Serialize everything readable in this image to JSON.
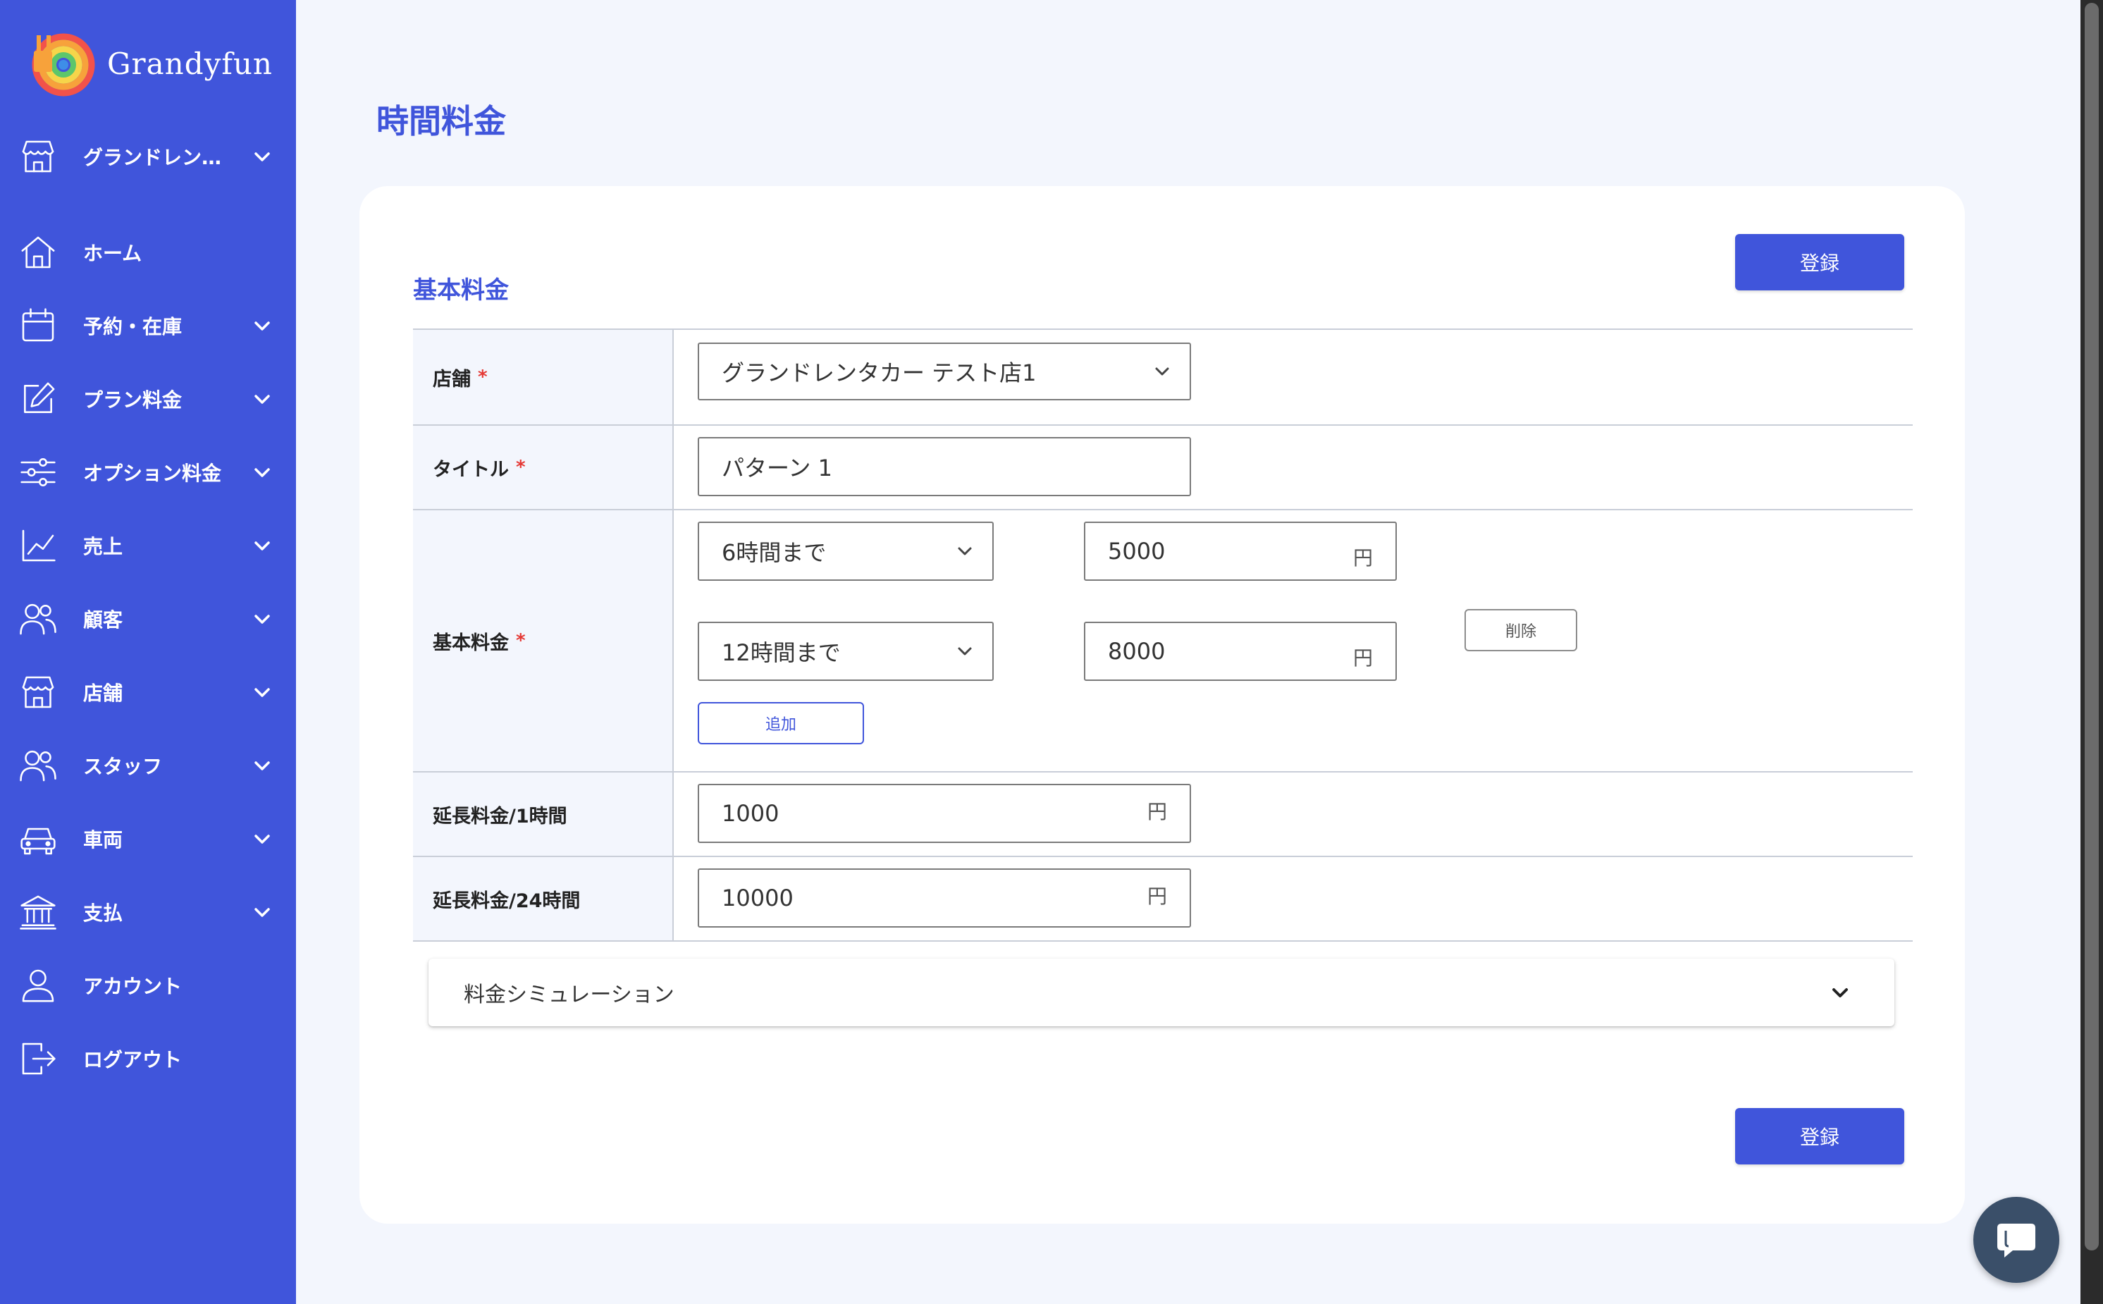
{
  "app": {
    "brand": "Grandyfun"
  },
  "sidebar": {
    "items": [
      {
        "label": "グランドレン…",
        "icon": "store-icon",
        "has_submenu": true
      },
      {
        "label": "ホーム",
        "icon": "home-icon",
        "has_submenu": false
      },
      {
        "label": "予約・在庫",
        "icon": "calendar-icon",
        "has_submenu": true
      },
      {
        "label": "プラン料金",
        "icon": "edit-icon",
        "has_submenu": true
      },
      {
        "label": "オプション料金",
        "icon": "sliders-icon",
        "has_submenu": true
      },
      {
        "label": "売上",
        "icon": "chart-line-icon",
        "has_submenu": true
      },
      {
        "label": "顧客",
        "icon": "users-icon",
        "has_submenu": true
      },
      {
        "label": "店舗",
        "icon": "store-icon",
        "has_submenu": true
      },
      {
        "label": "スタッフ",
        "icon": "users-icon",
        "has_submenu": true
      },
      {
        "label": "車両",
        "icon": "car-icon",
        "has_submenu": true
      },
      {
        "label": "支払",
        "icon": "bank-icon",
        "has_submenu": true
      },
      {
        "label": "アカウント",
        "icon": "user-icon",
        "has_submenu": false
      },
      {
        "label": "ログアウト",
        "icon": "logout-icon",
        "has_submenu": false
      }
    ]
  },
  "page": {
    "title": "時間料金"
  },
  "form": {
    "section_title": "基本料金",
    "submit_label": "登録",
    "required_mark": "*",
    "store": {
      "label": "店舗",
      "value": "グランドレンタカー テスト店1"
    },
    "title_field": {
      "label": "タイトル",
      "value": "パターン 1"
    },
    "base_fee": {
      "label": "基本料金",
      "rows": [
        {
          "duration": "6時間まで",
          "price": "5000",
          "unit": "円"
        },
        {
          "duration": "12時間まで",
          "price": "8000",
          "unit": "円"
        }
      ],
      "delete_label": "削除",
      "add_label": "追加"
    },
    "extension_1h": {
      "label": "延長料金/1時間",
      "value": "1000",
      "unit": "円"
    },
    "extension_24h": {
      "label": "延長料金/24時間",
      "value": "10000",
      "unit": "円"
    }
  },
  "simulation": {
    "label": "料金シミュレーション"
  },
  "colors": {
    "primary": "#4055db",
    "sidebar": "#4055db",
    "background": "#f3f6fd",
    "required": "#e53935",
    "chat": "#3a4f69"
  }
}
